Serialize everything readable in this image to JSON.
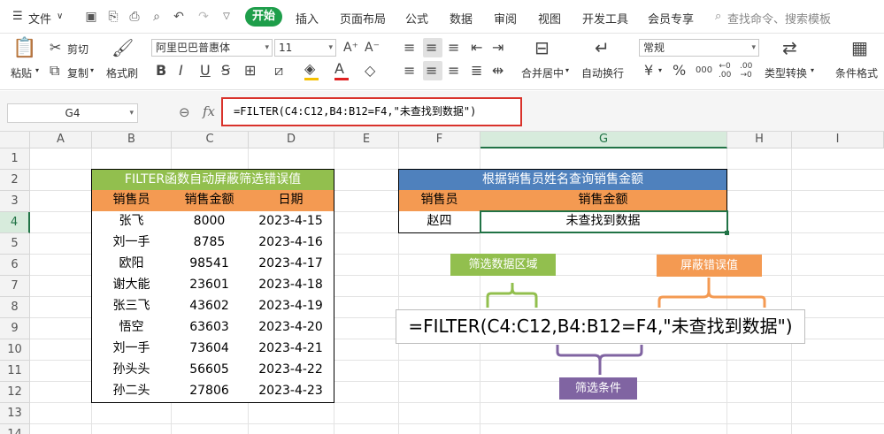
{
  "menu": {
    "file": "文件",
    "tabs": [
      "开始",
      "插入",
      "页面布局",
      "公式",
      "数据",
      "审阅",
      "视图",
      "开发工具",
      "会员专享"
    ],
    "search": "查找命令、搜索模板"
  },
  "ribbon": {
    "paste": "粘贴",
    "cut": "剪切",
    "copy": "复制",
    "format_painter": "格式刷",
    "font_name": "阿里巴巴普惠体",
    "font_size": "11",
    "merge_center": "合并居中",
    "wrap_text": "自动换行",
    "number_format": "常规",
    "type_convert": "类型转换",
    "conditional_format": "条件格式"
  },
  "formula_bar": {
    "name_box": "G4",
    "fx": "fx",
    "formula": "=FILTER(C4:C12,B4:B12=F4,\"未查找到数据\")"
  },
  "columns": [
    "A",
    "B",
    "C",
    "D",
    "E",
    "F",
    "G",
    "H",
    "I"
  ],
  "rows": [
    "1",
    "2",
    "3",
    "4",
    "5",
    "6",
    "7",
    "8",
    "9",
    "10",
    "11",
    "12",
    "13",
    "14"
  ],
  "left_table": {
    "title": "FILTER函数自动屏蔽筛选错误值",
    "headers": [
      "销售员",
      "销售金额",
      "日期"
    ],
    "rows": [
      [
        "张飞",
        "8000",
        "2023-4-15"
      ],
      [
        "刘一手",
        "8785",
        "2023-4-16"
      ],
      [
        "欧阳",
        "98541",
        "2023-4-17"
      ],
      [
        "谢大能",
        "23601",
        "2023-4-18"
      ],
      [
        "张三飞",
        "43602",
        "2023-4-19"
      ],
      [
        "悟空",
        "63603",
        "2023-4-20"
      ],
      [
        "刘一手",
        "73604",
        "2023-4-21"
      ],
      [
        "孙头头",
        "56605",
        "2023-4-22"
      ],
      [
        "孙二头",
        "27806",
        "2023-4-23"
      ]
    ]
  },
  "right_table": {
    "title": "根据销售员姓名查询销售金额",
    "headers": [
      "销售员",
      "销售金额"
    ],
    "name": "赵四",
    "result": "未查找到数据"
  },
  "annotations": {
    "filter_range": "筛选数据区域",
    "mask_error": "屏蔽错误值",
    "filter_condition": "筛选条件",
    "big_formula": "=FILTER(C4:C12,B4:B12=F4,\"未查找到数据\")"
  },
  "colors": {
    "green": "#92bf4e",
    "orange": "#f49a52",
    "blue": "#4f81bd",
    "purple": "#8064a2",
    "start_green": "#1e9e4a",
    "highlight_red": "#d9322b"
  }
}
